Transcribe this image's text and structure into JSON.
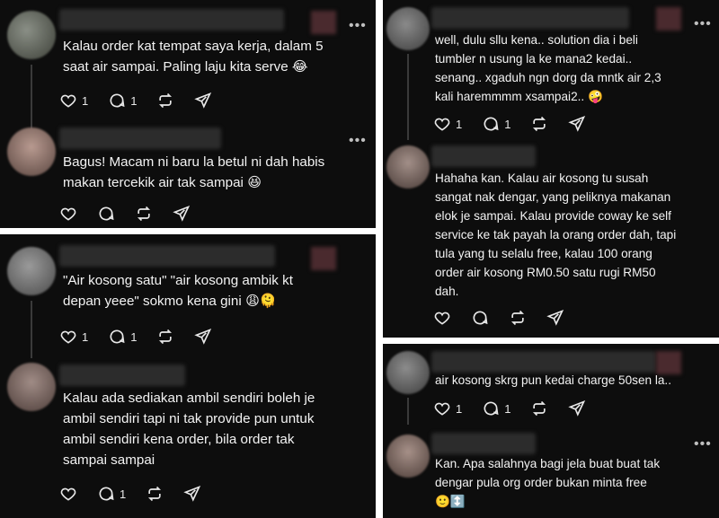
{
  "left": [
    {
      "text": "Kalau order kat tempat saya kerja, dalam 5\nsaat air sampai. Paling laju kita serve 😂",
      "likes": "1",
      "replies": "1"
    },
    {
      "text": "Bagus! Macam ni baru la betul ni dah habis\nmakan tercekik air tak sampai 😆",
      "likes": "",
      "replies": ""
    },
    {
      "text": "\"Air kosong satu\" \"air kosong ambik kt\ndepan yeee\" sokmo kena gini 😩🫠",
      "likes": "1",
      "replies": "1"
    },
    {
      "text": "Kalau ada sediakan ambil sendiri boleh je\nambil sendiri tapi ni tak provide pun untuk\nambil sendiri kena order, bila order tak\nsampai sampai",
      "likes": "",
      "replies": "1"
    }
  ],
  "right": [
    {
      "text": "well, dulu sllu kena.. solution dia i beli\ntumbler n usung la ke mana2 kedai..\nsenang.. xgaduh ngn dorg da mntk air 2,3\nkali haremmmm xsampai2.. 🤪",
      "likes": "1",
      "replies": "1"
    },
    {
      "text": "Hahaha kan. Kalau air kosong tu susah\nsangat nak dengar, yang peliknya makanan\nelok je sampai. Kalau provide coway ke self\nservice ke tak payah la orang order dah, tapi\ntula yang tu selalu free, kalau 100 orang\norder air kosong RM0.50 satu rugi RM50\ndah.",
      "likes": "",
      "replies": ""
    },
    {
      "text": "air kosong skrg pun kedai charge 50sen la..",
      "likes": "1",
      "replies": "1"
    },
    {
      "text": "Kan. Apa salahnya bagi jela buat buat tak\ndengar pula org order bukan minta free\n🙂↕️",
      "likes": "",
      "replies": ""
    }
  ],
  "more_glyph": "•••",
  "icons": [
    "heart-icon",
    "comment-icon",
    "repost-icon",
    "share-icon",
    "more-options-icon"
  ]
}
